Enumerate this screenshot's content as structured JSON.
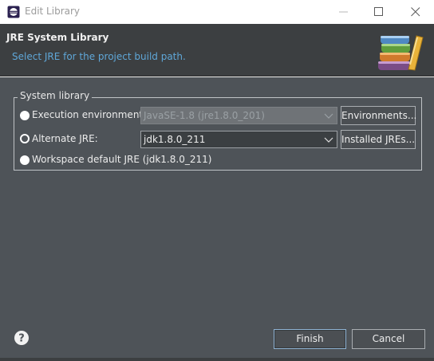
{
  "window": {
    "title": "Edit Library"
  },
  "header": {
    "title": "JRE System Library",
    "subtitle": "Select JRE for the project build path.",
    "icon": "library-books-icon"
  },
  "group": {
    "legend": "System library",
    "execution_env": {
      "label": "Execution environment:",
      "value": "JavaSE-1.8 (jre1.8.0_201)",
      "button": "Environments...",
      "selected": false
    },
    "alternate_jre": {
      "label": "Alternate JRE:",
      "value": "jdk1.8.0_211",
      "button": "Installed JREs...",
      "selected": true
    },
    "workspace_default": {
      "label": "Workspace default JRE (jdk1.8.0_211)",
      "selected": false
    }
  },
  "footer": {
    "help_icon": "question-icon",
    "finish": "Finish",
    "cancel": "Cancel"
  },
  "colors": {
    "dialog_bg": "#4e5358",
    "header_bg": "#3c3f41",
    "link_blue": "#5fa7d8",
    "accent_border": "#8fb3d3"
  }
}
